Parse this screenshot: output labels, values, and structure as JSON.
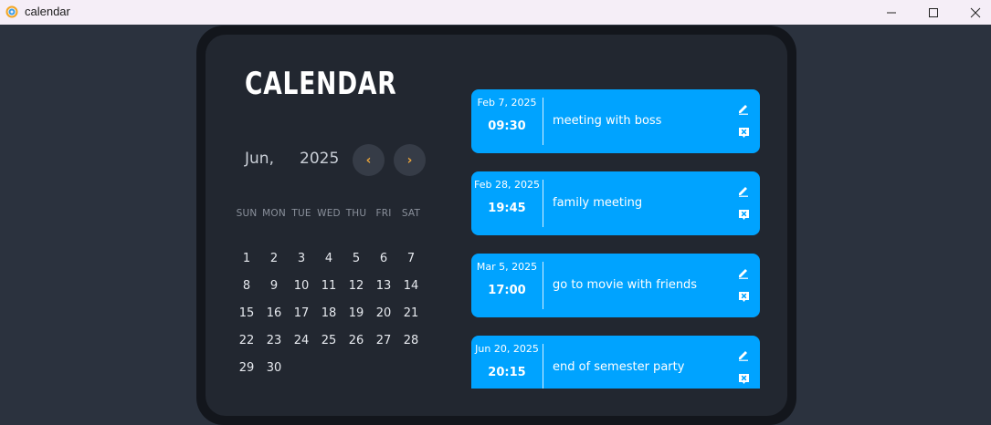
{
  "window": {
    "title": "calendar"
  },
  "header": {
    "title": "CALENDAR"
  },
  "calendar": {
    "month": "Jun,",
    "year": "2025",
    "weekdays": [
      "SUN",
      "MON",
      "TUE",
      "WED",
      "THU",
      "FRI",
      "SAT"
    ],
    "days": [
      "1",
      "2",
      "3",
      "4",
      "5",
      "6",
      "7",
      "8",
      "9",
      "10",
      "11",
      "12",
      "13",
      "14",
      "15",
      "16",
      "17",
      "18",
      "19",
      "20",
      "21",
      "22",
      "23",
      "24",
      "25",
      "26",
      "27",
      "28",
      "29",
      "30"
    ],
    "prev_icon": "‹",
    "next_icon": "›"
  },
  "events": [
    {
      "date": "Feb 7, 2025",
      "time": "09:30",
      "title": "meeting with boss"
    },
    {
      "date": "Feb 28, 2025",
      "time": "19:45",
      "title": "family meeting"
    },
    {
      "date": "Mar 5, 2025",
      "time": "17:00",
      "title": "go to movie with friends"
    },
    {
      "date": "Jun 20, 2025",
      "time": "20:15",
      "title": "end of semester party"
    }
  ],
  "colors": {
    "background": "#2b323e",
    "card": "#222730",
    "event": "#00a3ff",
    "accent": "#e8a33b"
  }
}
